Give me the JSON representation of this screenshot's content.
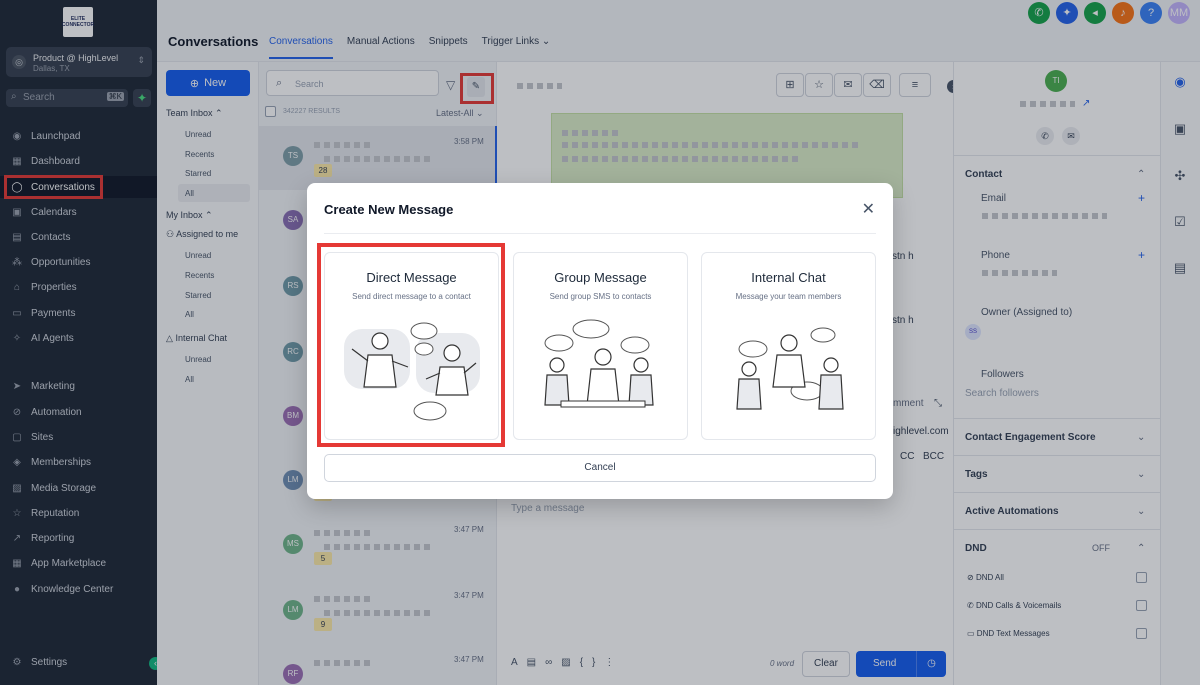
{
  "logo": {
    "text": "ELITE CONNECTOR"
  },
  "sidebar": {
    "location_name": "Product @ HighLevel",
    "location_sub": "Dallas, TX",
    "search_placeholder": "Search",
    "search_shortcut": "⌘K",
    "items": [
      {
        "label": "Launchpad",
        "icon": "rocket-icon"
      },
      {
        "label": "Dashboard",
        "icon": "grid-icon"
      },
      {
        "label": "Conversations",
        "icon": "chat-icon",
        "active": true
      },
      {
        "label": "Calendars",
        "icon": "calendar-icon"
      },
      {
        "label": "Contacts",
        "icon": "contacts-icon"
      },
      {
        "label": "Opportunities",
        "icon": "funnel-icon"
      },
      {
        "label": "Properties",
        "icon": "home-icon"
      },
      {
        "label": "Payments",
        "icon": "card-icon"
      },
      {
        "label": "AI Agents",
        "icon": "sparkle-icon"
      },
      {
        "label": "Marketing",
        "icon": "send-icon"
      },
      {
        "label": "Automation",
        "icon": "automation-icon"
      },
      {
        "label": "Sites",
        "icon": "sites-icon"
      },
      {
        "label": "Memberships",
        "icon": "membership-icon"
      },
      {
        "label": "Media Storage",
        "icon": "media-icon"
      },
      {
        "label": "Reputation",
        "icon": "star-icon"
      },
      {
        "label": "Reporting",
        "icon": "chart-icon"
      },
      {
        "label": "App Marketplace",
        "icon": "apps-icon"
      },
      {
        "label": "Knowledge Center",
        "icon": "info-icon"
      }
    ],
    "settings_label": "Settings"
  },
  "header": {
    "title": "Conversations",
    "tabs": [
      "Conversations",
      "Manual Actions",
      "Snippets",
      "Trigger Links"
    ],
    "avatar_initials": "MM"
  },
  "subnav": {
    "new_label": "New",
    "team_inbox": "Team Inbox",
    "team_items": [
      "Unread",
      "Recents",
      "Starred",
      "All"
    ],
    "my_inbox": "My Inbox",
    "assigned": "Assigned to me",
    "my_items": [
      "Unread",
      "Recents",
      "Starred",
      "All"
    ],
    "internal_chat": "Internal Chat",
    "internal_items": [
      "Unread",
      "All"
    ]
  },
  "list": {
    "search_placeholder": "Search",
    "results": "342227 RESULTS",
    "sort": "Latest-All",
    "items": [
      {
        "initials": "TS",
        "time": "3:58 PM",
        "badge": "28",
        "color": "#7e9ea8"
      },
      {
        "initials": "SA",
        "time": "",
        "badge": "",
        "color": "#8a6fb5"
      },
      {
        "initials": "RS",
        "time": "",
        "badge": "",
        "color": "#6f9aa8"
      },
      {
        "initials": "RC",
        "time": "",
        "badge": "",
        "color": "#6f9aa8"
      },
      {
        "initials": "BM",
        "time": "",
        "badge": "",
        "color": "#9b6fb5"
      },
      {
        "initials": "LM",
        "time": "",
        "badge": "2",
        "color": "#6f8fb5"
      },
      {
        "initials": "MS",
        "time": "3:47 PM",
        "badge": "5",
        "color": "#6fb58a"
      },
      {
        "initials": "LM",
        "time": "3:47 PM",
        "badge": "9",
        "color": "#6fb58a"
      },
      {
        "initials": "RF",
        "time": "3:47 PM",
        "badge": "",
        "color": "#9b6fb5"
      }
    ]
  },
  "main": {
    "type_placeholder": "Type a message",
    "word_count": "0 word",
    "clear_label": "Clear",
    "send_label": "Send",
    "partial_1": "stn h",
    "partial_2": "stn h",
    "partial_comment": "mment",
    "partial_email": "ighlevel.com",
    "cc": "CC",
    "bcc": "BCC"
  },
  "contact": {
    "avatar_initials": "TI",
    "contact_header": "Contact",
    "email_label": "Email",
    "phone_label": "Phone",
    "owner_label": "Owner (Assigned to)",
    "owner_initials": "SS",
    "followers_label": "Followers",
    "followers_placeholder": "Search followers",
    "engagement": "Contact Engagement Score",
    "tags": "Tags",
    "automations": "Active Automations",
    "dnd": "DND",
    "dnd_state": "OFF",
    "dnd_items": [
      "DND All",
      "DND Calls & Voicemails",
      "DND Text Messages"
    ]
  },
  "modal": {
    "title": "Create New Message",
    "cards": [
      {
        "title": "Direct Message",
        "subtitle": "Send direct message to a contact"
      },
      {
        "title": "Group Message",
        "subtitle": "Send group SMS to contacts"
      },
      {
        "title": "Internal Chat",
        "subtitle": "Message your team members"
      }
    ],
    "cancel": "Cancel"
  },
  "colors": {
    "primary": "#155eef",
    "highlight": "#e53935",
    "sidebar": "#1f2937"
  }
}
